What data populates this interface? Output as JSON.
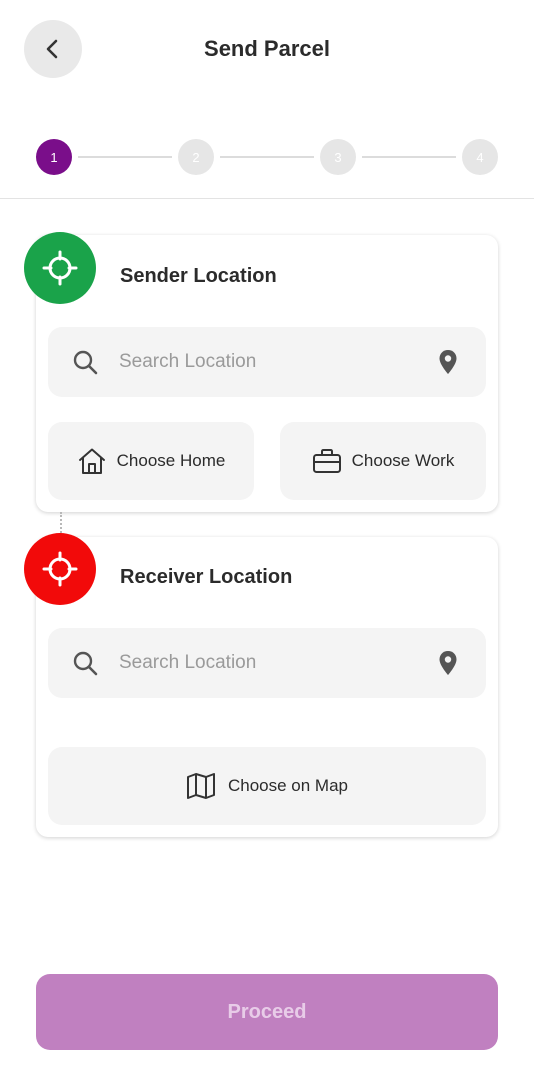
{
  "header": {
    "title": "Send Parcel",
    "back_icon": "chevron-left-icon"
  },
  "stepper": {
    "steps": [
      "1",
      "2",
      "3",
      "4"
    ],
    "active_index": 0,
    "active_color": "#7a0e8a",
    "inactive_color": "#e6e6e6"
  },
  "sender": {
    "title": "Sender Location",
    "icon": "crosshair-icon",
    "icon_color": "#1aa34a",
    "search_placeholder": "Search Location",
    "choose_home_label": "Choose Home",
    "choose_work_label": "Choose Work"
  },
  "receiver": {
    "title": "Receiver Location",
    "icon": "crosshair-icon",
    "icon_color": "#f20a0a",
    "search_placeholder": "Search Location",
    "choose_map_label": "Choose on Map"
  },
  "footer": {
    "proceed_label": "Proceed",
    "proceed_color": "#c080c0"
  }
}
